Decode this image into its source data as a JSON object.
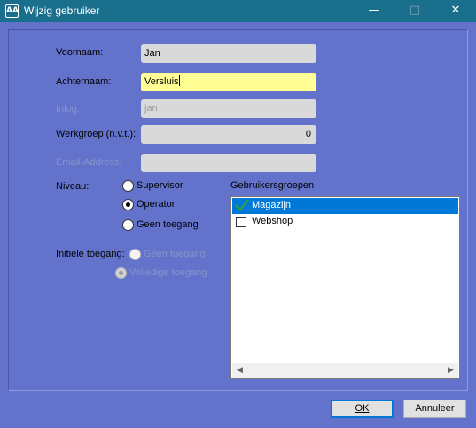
{
  "window": {
    "title": "Wijzig gebruiker",
    "app_icon_glyph": "AA",
    "minimize_glyph": "—",
    "maximize_glyph": "□",
    "close_glyph": "✕"
  },
  "form": {
    "voornaam_label": "Voornaam:",
    "voornaam_value": "Jan",
    "achternaam_label": "Achternaam:",
    "achternaam_value": "Versluis",
    "inlog_label": "Inlog:",
    "inlog_value": "jan",
    "werkgroep_label": "Werkgroep (n.v.t.):",
    "werkgroep_value": "0",
    "email_label": "Email-Address:",
    "email_value": ""
  },
  "niveau": {
    "label": "Niveau:",
    "options": [
      {
        "label": "Supervisor",
        "checked": false
      },
      {
        "label": "Operator",
        "checked": true
      },
      {
        "label": "Geen toegang",
        "checked": false
      }
    ]
  },
  "initiele_toegang": {
    "label": "Initiele toegang:",
    "options": [
      {
        "label": "Geen toegang",
        "checked": false,
        "enabled": false
      },
      {
        "label": "Volledige toegang",
        "checked": true,
        "enabled": false
      }
    ]
  },
  "gebruikersgroepen": {
    "label": "Gebruikersgroepen",
    "items": [
      {
        "label": "Magazijn",
        "checked": true,
        "selected": true
      },
      {
        "label": "Webshop",
        "checked": false,
        "selected": false
      }
    ]
  },
  "buttons": {
    "ok_label": "OK",
    "annuleer_label": "Annuleer"
  },
  "colors": {
    "window_bg": "#6373cc",
    "titlebar": "#1a6f8c",
    "selection": "#0078d7",
    "active_field": "#ffff96",
    "check_green": "#2ea043"
  }
}
